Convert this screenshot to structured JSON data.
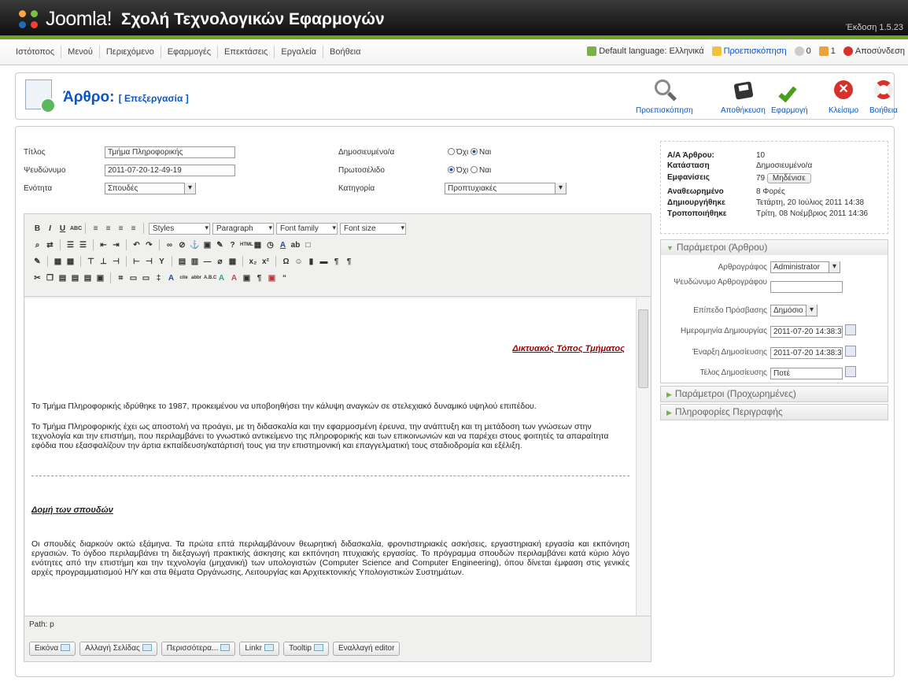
{
  "header": {
    "brand": "Joomla!",
    "site_name": "Σχολή Τεχνολογικών Εφαρμογών",
    "version": "Έκδοση 1.5.23"
  },
  "menu": {
    "items": [
      "Ιστότοπος",
      "Μενού",
      "Περιεχόμενο",
      "Εφαρμογές",
      "Επεκτάσεις",
      "Εργαλεία",
      "Βοήθεια"
    ],
    "default_language": "Default language: Ελληνικά",
    "preview": "Προεπισκόπηση",
    "messages": "0",
    "users": "1",
    "logout": "Αποσύνδεση"
  },
  "toolbar": {
    "title": "Άρθρο:",
    "subtitle": "[ Επεξεργασία ]",
    "preview": "Προεπισκόπηση",
    "save": "Αποθήκευση",
    "apply": "Εφαρμογή",
    "close": "Κλείσιμο",
    "help": "Βοήθεια"
  },
  "form": {
    "title_label": "Τίτλος",
    "title_value": "Τμήμα Πληροφορικής",
    "alias_label": "Ψευδώνυμο",
    "alias_value": "2011-07-20-12-49-19",
    "section_label": "Ενότητα",
    "section_value": "Σπουδές",
    "published_label": "Δημοσιευμένο/α",
    "frontpage_label": "Πρωτοσέλιδο",
    "no": "Όχι",
    "yes": "Ναι",
    "category_label": "Κατηγορία",
    "category_value": "Προπτυχιακές"
  },
  "editor": {
    "styles": "Styles",
    "format": "Paragraph",
    "font_family": "Font family",
    "font_size": "Font size",
    "link_heading": "Δικτυακός Τόπος Τμήματος",
    "p1": "Το Τμήμα Πληροφορικής ιδρύθηκε το 1987, προκειμένου να υποβοηθήσει την κάλυψη αναγκών σε στελεχιακό δυναμικό υψηλού επιπέδου.",
    "p2": "Το Τμήμα Πληροφορικής έχει ως αποστολή να προάγει, με τη διδασκαλία και την εφαρμοσμένη έρευνα, την ανάπτυξη και τη μετάδοση των γνώσεων στην τεχνολογία και την επιστήμη, που περιλαμβάνει το γνωστικό αντικείμενο της πληροφορικής και των επικοινωνιών και να παρέχει στους φοιτητές τα απαραίτητα εφόδια που εξασφαλίζουν την άρτια εκπαίδευση/κατάρτισή τους για την επιστημονική και επαγγελματική τους σταδιοδρομία και εξέλιξη.",
    "h2": "Δομή των σπουδών",
    "p3": "Οι σπουδές διαρκούν οκτώ εξάμηνα. Τα πρώτα επτά περιλαμβάνουν θεωρητική διδασκαλία, φροντιστηριακές ασκήσεις, εργαστηριακή εργασία και εκπόνηση εργασιών. Το όγδοο περιλαμβάνει τη διεξαγωγή πρακτικής άσκησης και εκπόνηση πτυχιακής εργασίας. Το πρόγραμμα σπουδών περιλαμβάνει κατά κύριο λόγο ενότητες από την επιστήμη και την τεχνολογία (μηχανική) των υπολογιστών (Computer Science and Computer Engineering), όπου δίνεται έμφαση στις γενικές αρχές προγραμματισμού Η/Υ και στα θέματα Οργάνωσης, Λειτουργίας και Αρχιτεκτονικής Υπολογιστικών Συστημάτων.",
    "path": "Path: p",
    "buttons": [
      "Εικόνα",
      "Αλλαγή Σελίδας",
      "Περισσότερα...",
      "Linkr",
      "Tooltip",
      "Εναλλαγή editor"
    ]
  },
  "info": {
    "id_label": "Α/Α Άρθρου:",
    "id_value": "10",
    "state_label": "Κατάσταση",
    "state_value": "Δημοσιευμένο/α",
    "hits_label": "Εμφανίσεις",
    "hits_value": "79",
    "reset": "Μηδένισε",
    "revised_label": "Αναθεωρημένο",
    "revised_value": "8 Φορές",
    "created_label": "Δημιουργήθηκε",
    "created_value": "Τετάρτη, 20 Ιούλιος 2011 14:38",
    "modified_label": "Τροποποιήθηκε",
    "modified_value": "Τρίτη, 08 Νοέμβριος 2011 14:36"
  },
  "params": {
    "title": "Παράμετροι (Άρθρου)",
    "author_label": "Αρθρογράφος",
    "author_value": "Administrator",
    "alias_label": "Ψευδώνυμο Αρθρογράφου",
    "access_label": "Επίπεδο Πρόσβασης",
    "access_value": "Δημόσιο",
    "created_label": "Ημερομηνία Δημιουργίας",
    "created_value": "2011-07-20 14:38:37",
    "start_label": "Έναρξη Δημοσίευσης",
    "start_value": "2011-07-20 14:38:37",
    "end_label": "Τέλος Δημοσίευσης",
    "end_value": "Ποτέ",
    "advanced": "Παράμετροι (Προχωρημένες)",
    "meta": "Πληροφορίες Περιγραφής"
  }
}
